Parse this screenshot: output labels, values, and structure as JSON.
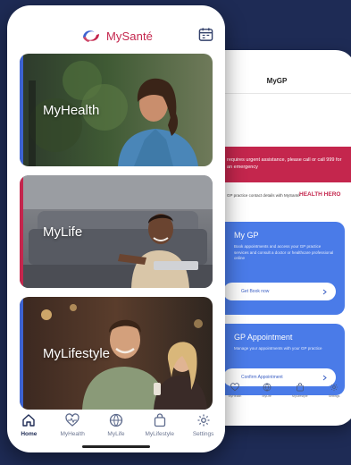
{
  "front": {
    "brand": "MySanté",
    "cards": [
      {
        "label": "MyHealth",
        "accent": "#3d63d1"
      },
      {
        "label": "MyLife",
        "accent": "#c4264d"
      },
      {
        "label": "MyLifestyle",
        "accent": "#3d63d1"
      }
    ],
    "tabs": [
      {
        "label": "Home",
        "icon": "home-icon",
        "active": true
      },
      {
        "label": "MyHealth",
        "icon": "heart-pulse-icon"
      },
      {
        "label": "MyLife",
        "icon": "globe-icon"
      },
      {
        "label": "MyLifestyle",
        "icon": "bag-icon"
      },
      {
        "label": "Settings",
        "icon": "gear-icon"
      }
    ]
  },
  "back": {
    "title": "MyGP",
    "alert_text": "requires urgent assistance, please call or call 999 for an emergency",
    "contact_text": "GP practice contact details with MySanté",
    "health_badge": "HEALTH HERO",
    "cards": [
      {
        "title": "My GP",
        "desc": "Book appointments and access your GP practice services and consult a doctor or healthcare professional online",
        "button": "Get Book now"
      },
      {
        "title": "GP Appointment",
        "desc": "Manage your appointments with your GP practice",
        "button": "Confirm Appointment"
      }
    ],
    "nav": [
      {
        "label": "MyHealth",
        "icon": "heart-pulse-icon"
      },
      {
        "label": "MyLife",
        "icon": "globe-icon"
      },
      {
        "label": "MyLifestyle",
        "icon": "bag-icon"
      },
      {
        "label": "Settings",
        "icon": "gear-icon"
      }
    ]
  },
  "colors": {
    "background": "#1e2b55",
    "brand_red": "#c4264d",
    "brand_blue": "#4a7be8"
  }
}
